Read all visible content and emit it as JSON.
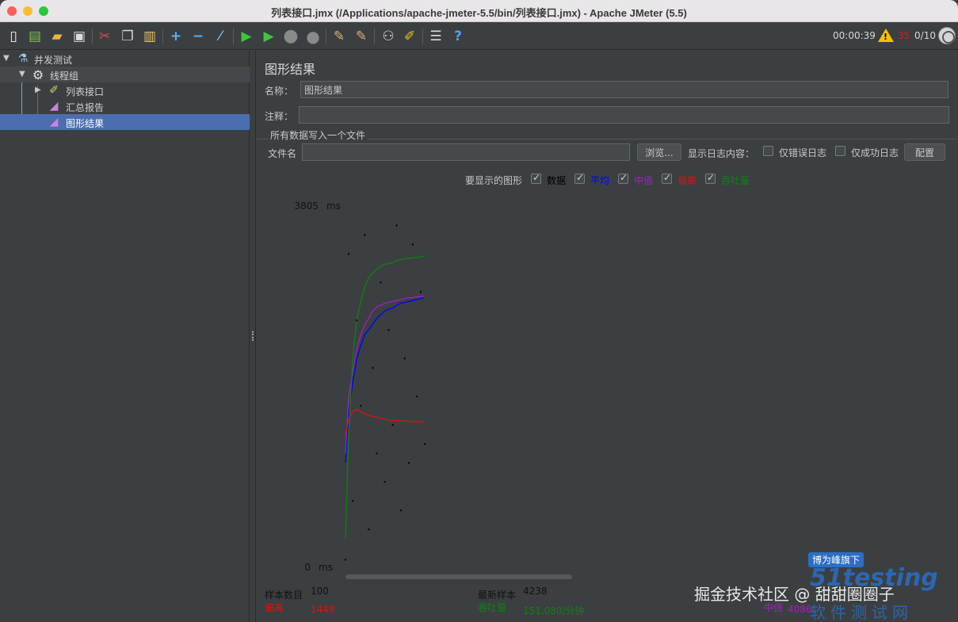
{
  "window": {
    "title": "列表接口.jmx (/Applications/apache-jmeter-5.5/bin/列表接口.jmx) - Apache JMeter (5.5)",
    "traffic_colors": [
      "#fe5f57",
      "#febc2e",
      "#28c840"
    ]
  },
  "toolbar": {
    "timer": "00:00:39",
    "error_count": "35",
    "threads": "0/10",
    "icons": [
      "new-icon",
      "templates-icon",
      "open-icon",
      "save-icon",
      "cut-icon",
      "copy-icon",
      "paste-icon",
      "expand-icon",
      "collapse-icon",
      "toggle-icon",
      "start-icon",
      "start-no-pause-icon",
      "stop-icon",
      "shutdown-icon",
      "clear-icon",
      "clear-all-icon",
      "search-icon",
      "reset-search-icon",
      "function-helper-icon",
      "help-icon"
    ]
  },
  "tree": {
    "items": [
      {
        "label": "并发测试",
        "icon": "test-plan-icon"
      },
      {
        "label": "线程组",
        "icon": "thread-group-icon"
      },
      {
        "label": "列表接口",
        "icon": "http-sampler-icon"
      },
      {
        "label": "汇总报告",
        "icon": "listener-icon"
      },
      {
        "label": "图形结果",
        "icon": "listener-icon"
      }
    ]
  },
  "panel": {
    "title": "图形结果",
    "name_label": "名称：",
    "name_value": "图形结果",
    "comment_label": "注释：",
    "comment_value": "",
    "fieldset_title": "所有数据写入一个文件",
    "filename_label": "文件名",
    "filename_value": "",
    "browse_button": "浏览...",
    "log_label": "显示日志内容：",
    "errors_only": "仅错误日志",
    "success_only": "仅成功日志",
    "configure_button": "配置",
    "graphs_label": "要显示的图形",
    "graph_options": [
      {
        "label": "数据",
        "color": "#000000",
        "checked": true
      },
      {
        "label": "平均",
        "color": "#0000ff",
        "checked": true
      },
      {
        "label": "中值",
        "color": "#a020c0",
        "checked": true
      },
      {
        "label": "偏离",
        "color": "#e01010",
        "checked": true
      },
      {
        "label": "吞吐量",
        "color": "#108010",
        "checked": true
      }
    ]
  },
  "chart_data": {
    "type": "scatter",
    "ymax_label": "3805",
    "ymin_label": "0",
    "unit": "ms",
    "ylim": [
      0,
      3805
    ],
    "n_samples": 100,
    "x": [
      1,
      5,
      10,
      15,
      20,
      25,
      30,
      35,
      40,
      45,
      50,
      55,
      60,
      65,
      70,
      75,
      80,
      85,
      90,
      95,
      100
    ],
    "series": [
      {
        "name": "平均",
        "color": "#0000ff",
        "values": [
          1100,
          1600,
          1950,
          2200,
          2330,
          2450,
          2500,
          2560,
          2620,
          2660,
          2700,
          2720,
          2730,
          2760,
          2780,
          2790,
          2800,
          2810,
          2820,
          2830,
          2840
        ]
      },
      {
        "name": "中值",
        "color": "#a020c0",
        "values": [
          1200,
          1800,
          2050,
          2300,
          2450,
          2550,
          2620,
          2700,
          2740,
          2760,
          2780,
          2790,
          2800,
          2810,
          2820,
          2830,
          2840,
          2840,
          2850,
          2850,
          2860
        ]
      },
      {
        "name": "偏离",
        "color": "#e01010",
        "values": [
          1400,
          1560,
          1640,
          1660,
          1640,
          1620,
          1600,
          1590,
          1580,
          1570,
          1560,
          1550,
          1550,
          1545,
          1540,
          1540,
          1535,
          1535,
          1535,
          1530,
          1530
        ]
      },
      {
        "name": "吞吐量",
        "color": "#108010",
        "values": [
          300,
          1400,
          2200,
          2600,
          2800,
          2950,
          3050,
          3100,
          3140,
          3170,
          3190,
          3200,
          3210,
          3230,
          3240,
          3250,
          3255,
          3260,
          3265,
          3270,
          3280
        ]
      },
      {
        "name": "数据",
        "color": "#000000",
        "values": [
          80,
          3300,
          700,
          2600,
          1700,
          3500,
          400,
          2100,
          1200,
          3000,
          900,
          2500,
          1500,
          3600,
          600,
          2200,
          1100,
          3400,
          1800,
          2900,
          1300
        ]
      }
    ]
  },
  "stats": {
    "samples_label": "样本数目",
    "samples_value": "100",
    "latest_label": "最新样本",
    "latest_value": "4238",
    "deviation_label": "偏离",
    "deviation_value": "1449",
    "throughput_label": "吞吐量",
    "throughput_value": "151.080/分钟",
    "median_label": "中值",
    "median_value": "4086"
  },
  "watermarks": {
    "juejin": "掘金技术社区 @ 甜甜圈圈子",
    "badge": "博为峰旗下",
    "brand": "51testing",
    "brand_cn": "软件测试网"
  }
}
